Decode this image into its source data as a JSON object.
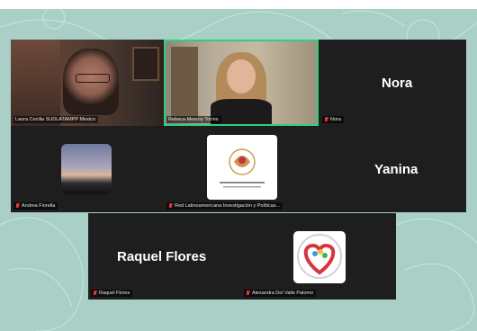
{
  "participants": {
    "p1": {
      "label": "Laura Cecilia SUDLATAMPP Mexico"
    },
    "p2": {
      "label": "Rebeca Monroy Torres"
    },
    "p3": {
      "label": "Nora",
      "display_name": "Nora"
    },
    "p4": {
      "label": "Andrea Fiorella"
    },
    "p5": {
      "label": "Red Latinoamericana Investigación y Políticas..."
    },
    "p6": {
      "label": "Yanina",
      "display_name": "Yanina"
    },
    "p7": {
      "label": "Raquel Flores",
      "display_name": "Raquel Flores"
    },
    "p8": {
      "label": "Alexandra Del Valle Palomo"
    }
  },
  "colors": {
    "background": "#a9cfc7",
    "tile": "#1e1e1e",
    "active_speaker_border": "#2fd07a",
    "muted_mic": "#e8353b"
  },
  "icons": [
    "mic-muted-icon",
    "heart-logo-icon",
    "network-logo-icon"
  ]
}
